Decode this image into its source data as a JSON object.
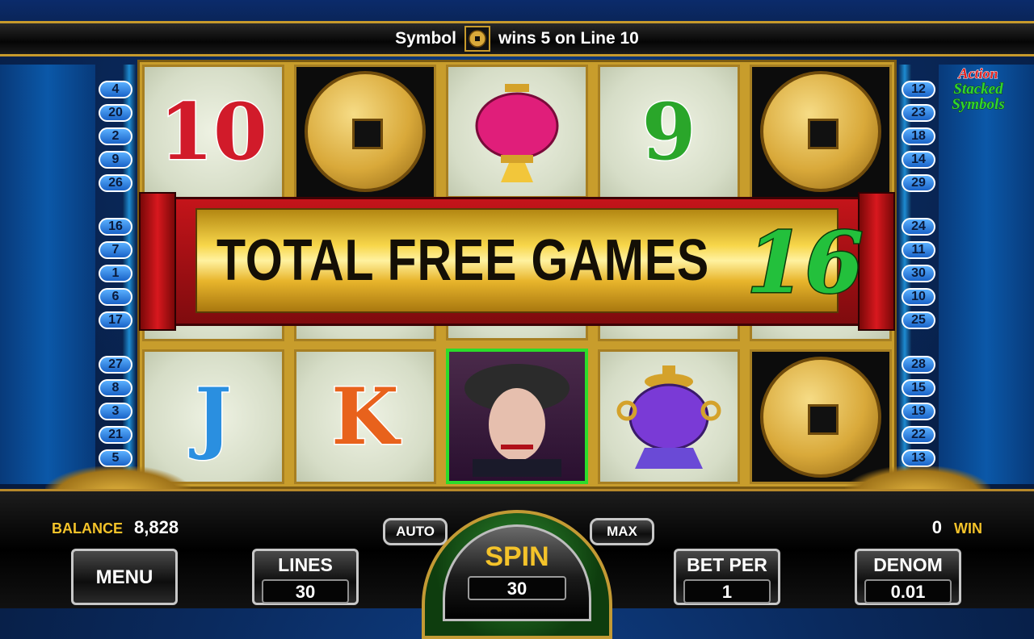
{
  "message": {
    "prefix": "Symbol",
    "suffix": "wins 5 on Line 10",
    "symbol_icon": "coin-icon"
  },
  "left_lines": [
    "4",
    "20",
    "2",
    "9",
    "26",
    "16",
    "7",
    "1",
    "6",
    "17",
    "27",
    "8",
    "3",
    "21",
    "5"
  ],
  "right_lines": [
    "12",
    "23",
    "18",
    "14",
    "29",
    "24",
    "11",
    "30",
    "10",
    "25",
    "28",
    "15",
    "19",
    "22",
    "13"
  ],
  "logo": {
    "line1": "Action",
    "line2": "Stacked",
    "line3": "Symbols"
  },
  "reels": [
    [
      {
        "sym": "10",
        "color": "#d11b2a"
      },
      {
        "sym": "",
        "kind": "hidden"
      },
      {
        "sym": "J",
        "color": "#2a8fe0"
      }
    ],
    [
      {
        "sym": "coin",
        "kind": "coin"
      },
      {
        "sym": "",
        "kind": "hidden"
      },
      {
        "sym": "K",
        "color": "#e8621c"
      }
    ],
    [
      {
        "sym": "lantern",
        "kind": "lantern"
      },
      {
        "sym": "",
        "kind": "hidden"
      },
      {
        "sym": "woman",
        "kind": "woman"
      }
    ],
    [
      {
        "sym": "9",
        "color": "#2aa62a"
      },
      {
        "sym": "",
        "kind": "hidden"
      },
      {
        "sym": "urn",
        "kind": "urn"
      }
    ],
    [
      {
        "sym": "coin",
        "kind": "coin"
      },
      {
        "sym": "",
        "kind": "hidden"
      },
      {
        "sym": "coin",
        "kind": "coin"
      }
    ]
  ],
  "banner": {
    "text": "TOTAL FREE GAMES",
    "count": "16"
  },
  "balance": {
    "label": "BALANCE",
    "value": "8,828"
  },
  "win": {
    "label": "WIN",
    "value": "0"
  },
  "buttons": {
    "menu": "MENU",
    "auto": "AUTO",
    "max": "MAX",
    "lines": {
      "label": "LINES",
      "value": "30"
    },
    "spin": {
      "label": "SPIN",
      "value": "30"
    },
    "bet_per": {
      "label": "BET PER",
      "value": "1"
    },
    "denom": {
      "label": "DENOM",
      "value": "0.01"
    }
  },
  "colors": {
    "accent_gold": "#f4c32a",
    "win_line_green": "#2bdc2b",
    "banner_red": "#c4141a"
  }
}
